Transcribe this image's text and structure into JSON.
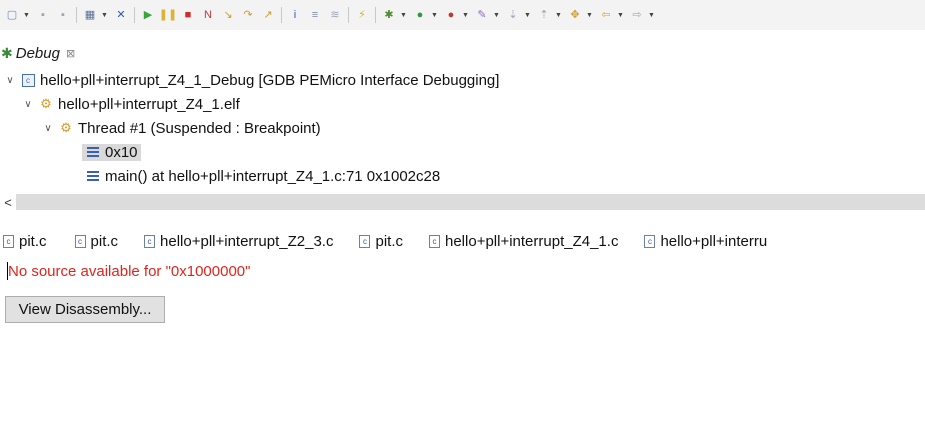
{
  "toolbar": {
    "items": [
      {
        "icon": "new-launch-icon",
        "glyph": "▢",
        "color": "#6b8ec6"
      },
      {
        "icon": "save-icon",
        "glyph": "▪",
        "color": "#9aa6b8"
      },
      {
        "icon": "save-all-icon",
        "glyph": "▪",
        "color": "#9aa6b8"
      },
      {
        "icon": "disassembly-icon",
        "glyph": "▦",
        "color": "#5a6f96"
      },
      {
        "icon": "skip-breakpoints-icon",
        "glyph": "✕",
        "color": "#2f5aa8"
      },
      {
        "icon": "resume-icon",
        "glyph": "▶",
        "color": "#3ba53b"
      },
      {
        "icon": "suspend-icon",
        "glyph": "❚❚",
        "color": "#d9b43a"
      },
      {
        "icon": "terminate-icon",
        "glyph": "■",
        "color": "#d0282b"
      },
      {
        "icon": "disconnect-icon",
        "glyph": "N",
        "color": "#c0393b"
      },
      {
        "icon": "step-into-icon",
        "glyph": "↘",
        "color": "#d49a2a"
      },
      {
        "icon": "step-over-icon",
        "glyph": "↷",
        "color": "#d49a2a"
      },
      {
        "icon": "step-return-icon",
        "glyph": "↗",
        "color": "#d49a2a"
      },
      {
        "icon": "instruction-stepping-icon",
        "glyph": "i",
        "color": "#2f5aa8"
      },
      {
        "icon": "reset-icon",
        "glyph": "≡",
        "color": "#7d8da8"
      },
      {
        "icon": "restart-icon",
        "glyph": "≋",
        "color": "#9aa6b8"
      },
      {
        "icon": "connect-icon",
        "glyph": "⚡",
        "color": "#e0b21a"
      },
      {
        "icon": "debug-icon",
        "glyph": "✱",
        "color": "#4f8a2f"
      },
      {
        "icon": "run-icon",
        "glyph": "●",
        "color": "#2d9b3a"
      },
      {
        "icon": "external-tools-icon",
        "glyph": "●",
        "color": "#c0392b"
      },
      {
        "icon": "pen-icon",
        "glyph": "✎",
        "color": "#8b6fb8"
      },
      {
        "icon": "next-annotation-icon",
        "glyph": "⇣",
        "color": "#9aa6b8"
      },
      {
        "icon": "previous-annotation-icon",
        "glyph": "⇡",
        "color": "#9aa6b8"
      },
      {
        "icon": "last-edit-location-icon",
        "glyph": "✥",
        "color": "#d49a2a"
      },
      {
        "icon": "back-icon",
        "glyph": "⇦",
        "color": "#e0a21a"
      },
      {
        "icon": "forward-icon",
        "glyph": "⇨",
        "color": "#9aa6b8"
      }
    ]
  },
  "debug_view": {
    "title": "Debug",
    "close_glyph": "⊠"
  },
  "tree": {
    "launch": "hello+pll+interrupt_Z4_1_Debug [GDB PEMicro Interface Debugging]",
    "process": "hello+pll+interrupt_Z4_1.elf",
    "thread": "Thread #1 (Suspended : Breakpoint)",
    "frames": [
      "0x10",
      "main() at hello+pll+interrupt_Z4_1.c:71 0x1002c28"
    ]
  },
  "scrollbar": {
    "left_arrow": "<"
  },
  "editor_tabs": [
    "pit.c",
    "pit.c",
    "hello+pll+interrupt_Z2_3.c",
    "pit.c",
    "hello+pll+interrupt_Z4_1.c",
    "hello+pll+interru"
  ],
  "editor": {
    "message": "No source available for \"0x1000000\"",
    "button": "View Disassembly..."
  }
}
